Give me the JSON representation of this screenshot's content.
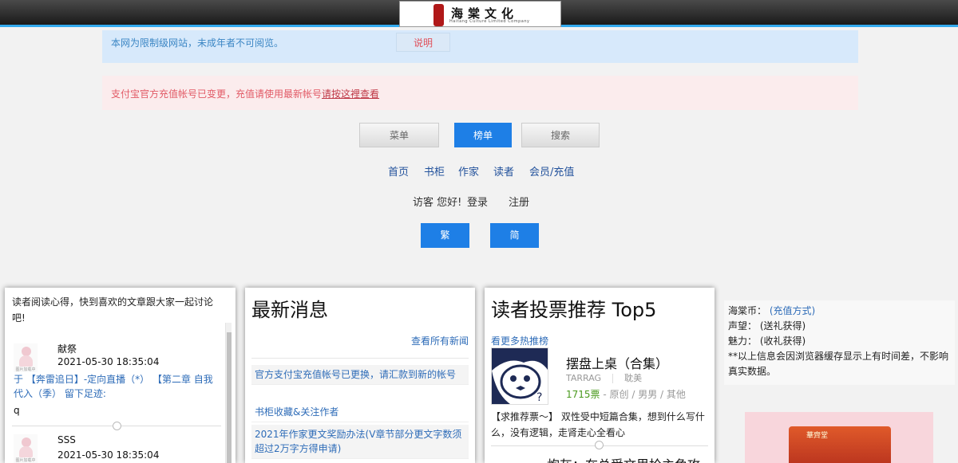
{
  "header": {
    "logo_name": "海棠文化",
    "logo_sub": "Haitang Culture Limited Company",
    "logo_seal": "海棠"
  },
  "notices": {
    "restricted_text": "本网为限制级网站，未成年者不可阅览。",
    "restricted_button": "说明",
    "alipay_text": "支付宝官方充值帐号已变更，充值请使用最新帐号",
    "alipay_link": "请按这裡查看"
  },
  "tabs": [
    {
      "label": "菜单",
      "active": false
    },
    {
      "label": "榜单",
      "active": true
    },
    {
      "label": "搜索",
      "active": false
    }
  ],
  "nav": [
    "首页",
    "书柜",
    "作家",
    "读者",
    "会员/充值"
  ],
  "visitor": {
    "greeting": "访客 您好!",
    "login": "登录",
    "register": "注册"
  },
  "script_buttons": [
    "繁",
    "简"
  ],
  "reader_panel": {
    "intro": "读者阅读心得，快到喜欢的文章跟大家一起讨论吧!",
    "comments": [
      {
        "user": "献祭",
        "time": "2021-05-30 18:35:04",
        "body": "于 【奔雷追日】-定向直播（*） 【第二章 自我代入（季） 留下足迹:",
        "text": "q"
      },
      {
        "user": "SSS",
        "time": "2021-05-30 18:35:04"
      }
    ],
    "avatar_caption": "图片加载中"
  },
  "news_panel": {
    "title": "最新消息",
    "more": "查看所有新闻",
    "items": [
      "官方支付宝充值帐号已更换，请汇款到新的帐号",
      "书柜收藏&关注作者",
      "2021年作家更文奖励办法(V章节部分更文字数须超过2万字方得申请)"
    ]
  },
  "vote_panel": {
    "title": "读者投票推荐 Top5",
    "more": "看更多热推榜",
    "book": {
      "title": "摆盘上桌（合集）",
      "author": "TARRAG",
      "category": "耽美",
      "votes": "1715票",
      "tags": "- 原创 / 男男 / 其他",
      "desc": "【求推荐票～】 双性受中短篇合集，想到什么写什么，没有逻辑，走肾走心全看心"
    },
    "next_title": "炮灰：在总受文里抢主角攻"
  },
  "info_panel": {
    "coin_label": "海棠币：",
    "coin_link": "(充值方式)",
    "fame_label": "声望：",
    "fame_value": "(送礼获得)",
    "charm_label": "魅力：",
    "charm_value": "(收礼获得)",
    "note": "**以上信息会因浏览器缓存显示上有时间差，不影响真实数据。"
  },
  "ad": {
    "brand": "華齊堂"
  },
  "colors": {
    "accent": "#1e7fe6",
    "link": "#2e6cb8",
    "notice_blue_bg": "#d7e9fb",
    "notice_pink_bg": "#fbeced",
    "votes_green": "#4a9a1e"
  }
}
